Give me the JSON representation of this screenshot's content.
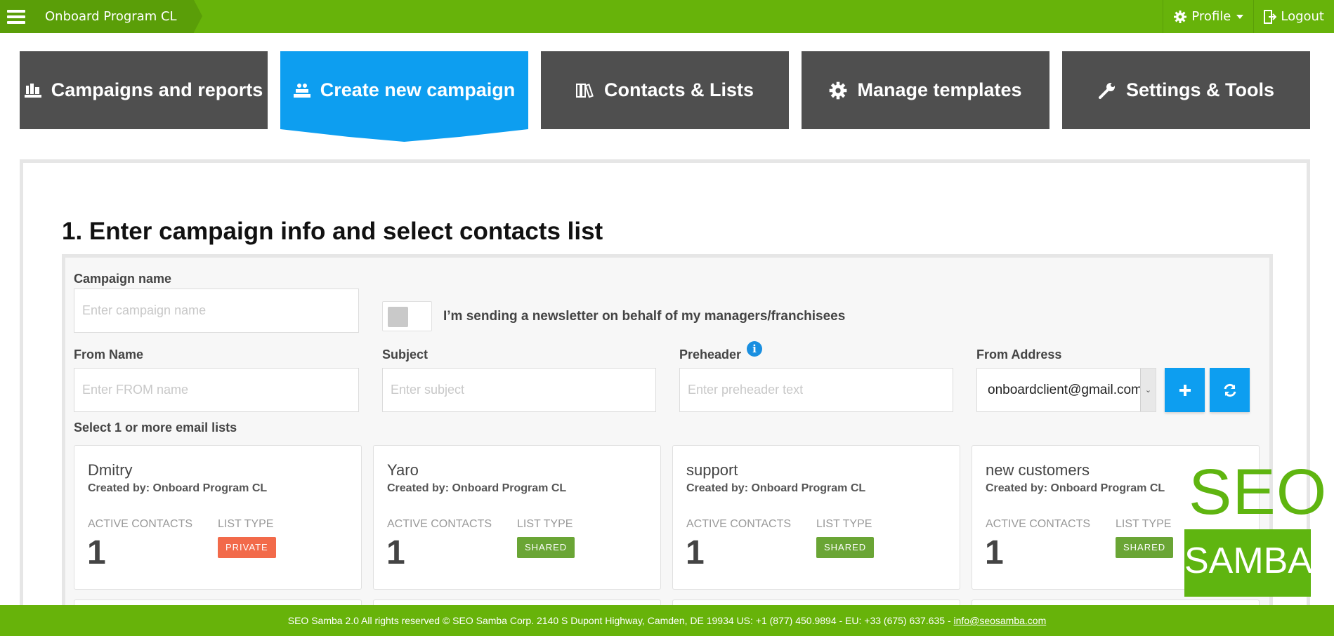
{
  "topbar": {
    "breadcrumb": "Onboard Program CL",
    "profile_label": "Profile",
    "logout_label": "Logout"
  },
  "nav": {
    "tiles": [
      {
        "label": "Campaigns and reports",
        "icon": "campaigns-icon"
      },
      {
        "label": "Create new campaign",
        "icon": "create-campaign-icon",
        "active": true
      },
      {
        "label": "Contacts & Lists",
        "icon": "books-icon"
      },
      {
        "label": "Manage templates",
        "icon": "gear-icon"
      },
      {
        "label": "Settings & Tools",
        "icon": "wrench-icon"
      }
    ]
  },
  "step": {
    "title": "1. Enter campaign info and select contacts list"
  },
  "form": {
    "campaign_name_label": "Campaign name",
    "campaign_name_placeholder": "Enter campaign name",
    "toggle_label": "I’m sending a newsletter on behalf of my managers/franchisees",
    "from_name_label": "From Name",
    "from_name_placeholder": "Enter FROM name",
    "subject_label": "Subject",
    "subject_placeholder": "Enter subject",
    "preheader_label": "Preheader",
    "preheader_placeholder": "Enter preheader text",
    "from_address_label": "From Address",
    "from_address_value": "onboardclient@gmail.com",
    "lists_label": "Select 1 or more email lists"
  },
  "lists": {
    "active_contacts_label": "ACTIVE CONTACTS",
    "list_type_label": "LIST TYPE",
    "cards": [
      {
        "name": "Dmitry",
        "created_by": "Created by: Onboard Program CL",
        "active_contacts": "1",
        "list_type": "PRIVATE"
      },
      {
        "name": "Yaro",
        "created_by": "Created by: Onboard Program CL",
        "active_contacts": "1",
        "list_type": "SHARED"
      },
      {
        "name": "support",
        "created_by": "Created by: Onboard Program CL",
        "active_contacts": "1",
        "list_type": "SHARED"
      },
      {
        "name": "new customers",
        "created_by": "Created by: Onboard Program CL",
        "active_contacts": "1",
        "list_type": "SHARED"
      }
    ]
  },
  "logo": {
    "line1": "SEO",
    "line2": "SAMBA"
  },
  "footer": {
    "text": "SEO Samba 2.0  All rights reserved © SEO Samba Corp. 2140 S Dupont Highway, Camden, DE 19934 US: +1 (877) 450.9894 - EU: +33 (675) 637.635 - ",
    "email": "info@seosamba.com"
  },
  "colors": {
    "brand_green": "#67b30a",
    "accent_blue": "#0d9ef0",
    "tile_dark": "#4f4f4f",
    "badge_private": "#f26a4a",
    "badge_shared": "#6aa535"
  }
}
